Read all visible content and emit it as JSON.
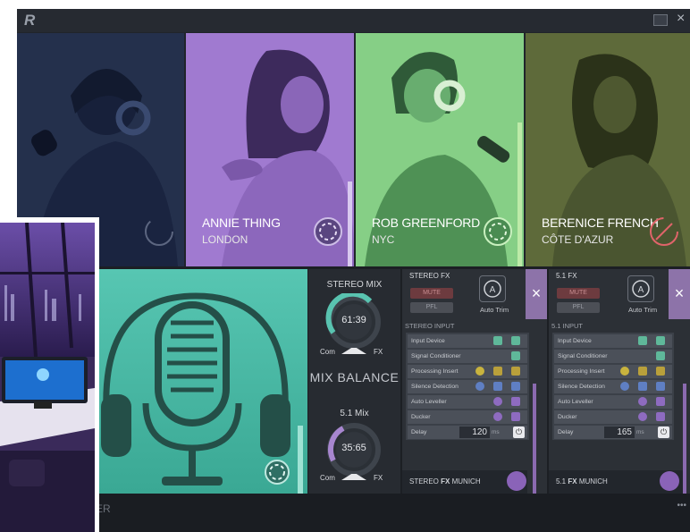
{
  "app": {
    "logo": "R",
    "close_glyph": "×"
  },
  "presenters": [
    {
      "name": "",
      "city": "",
      "bg": "#23304d",
      "fg": "#151d32"
    },
    {
      "name": "ANNIE THING",
      "city": "LONDON",
      "bg": "#a07ad0",
      "fg": "#5e3f84"
    },
    {
      "name": "ROB GREENFORD",
      "city": "NYC",
      "bg": "#86d088",
      "fg": "#3f7a4b"
    },
    {
      "name": "BERENICE FRENCH",
      "city": "CÔTE D'AZUR",
      "bg": "#5f6a3b",
      "fg": "#2e3520"
    }
  ],
  "mix": {
    "stereo_label": "STEREO MIX",
    "stereo_value": "61:39",
    "balance_label": "MIX BALANCE",
    "surround_label": "5.1 Mix",
    "surround_value": "35:65",
    "com_label": "Com",
    "fx_label": "FX"
  },
  "stereo_fx": {
    "title": "STEREO FX",
    "mute": "MUTE",
    "pfl": "PFL",
    "auto_trim": "Auto Trim",
    "section": "STEREO INPUT",
    "rows": [
      "Input Device",
      "Signal Conditioner",
      "Processing Insert",
      "Silence Detection",
      "Auto Leveller",
      "Ducker",
      "Delay"
    ],
    "delay_value": "120",
    "delay_unit": "ms",
    "footer_prefix": "STEREO",
    "footer_bold": "FX",
    "footer_suffix": "MUNICH"
  },
  "surround_fx": {
    "title": "5.1 FX",
    "mute": "MUTE",
    "pfl": "PFL",
    "auto_trim": "Auto Trim",
    "section": "5.1 INPUT",
    "rows": [
      "Input Device",
      "Signal Conditioner",
      "Processing Insert",
      "Silence Detection",
      "Auto Leveller",
      "Ducker",
      "Delay"
    ],
    "delay_value": "165",
    "delay_unit": "ms",
    "footer_prefix": "5.1",
    "footer_bold": "FX",
    "footer_suffix": "MUNICH"
  },
  "statusbar": {
    "text": "ER",
    "dots": "•••"
  },
  "colors": {
    "accent_purple": "#8d73a9",
    "mic_teal": "#4bb9a5"
  }
}
